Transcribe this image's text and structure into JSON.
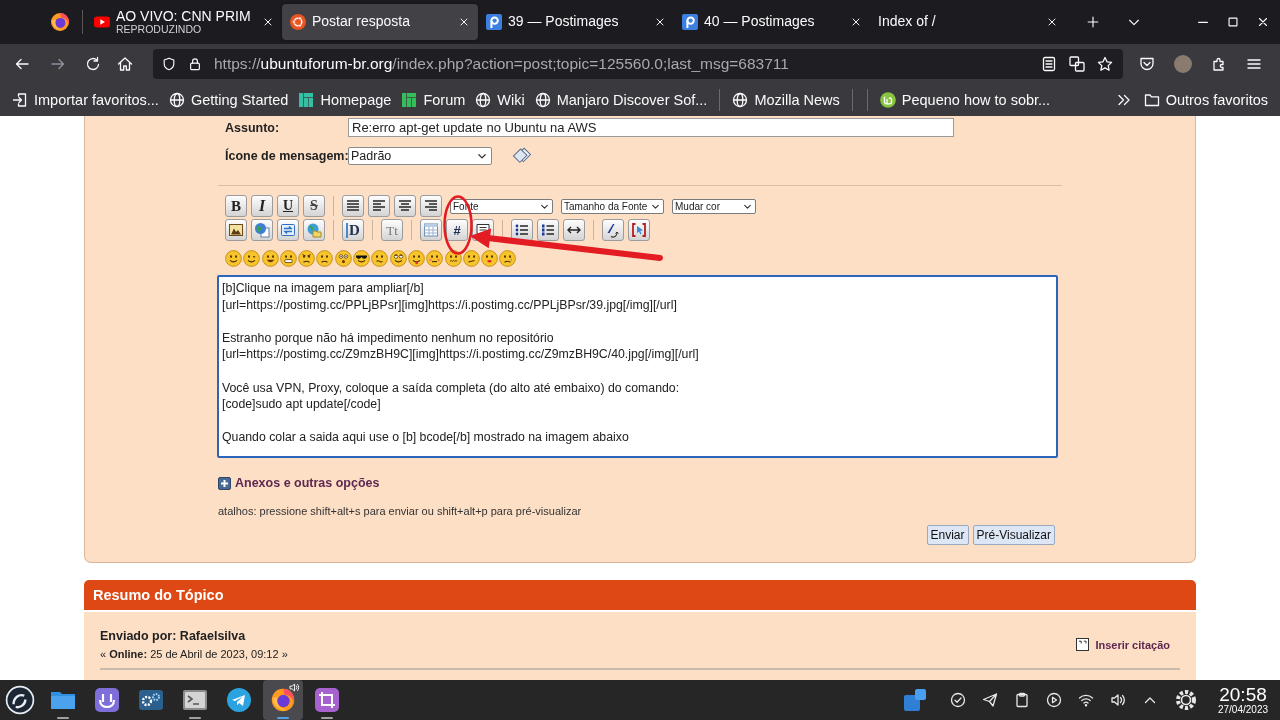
{
  "browser": {
    "tabs": [
      {
        "kind": "youtube",
        "title": "AO VIVO: CNN PRIM",
        "subtitle": "REPRODUZINDO",
        "selected": false
      },
      {
        "kind": "ubuntu",
        "title": "Postar resposta",
        "selected": true
      },
      {
        "kind": "postimages",
        "title": "39 — Postimages",
        "selected": false
      },
      {
        "kind": "postimages",
        "title": "40 — Postimages",
        "selected": false
      },
      {
        "kind": "none",
        "title": "Index of /",
        "selected": false
      }
    ],
    "address": {
      "scheme": "https://",
      "host": "ubuntuforum-br.org",
      "path": "/index.php?action=post;topic=125560.0;last_msg=683711"
    },
    "bookmarks": [
      {
        "kind": "import",
        "label": "Importar favoritos..."
      },
      {
        "kind": "globe",
        "label": "Getting Started"
      },
      {
        "kind": "manjaro",
        "label": "Homepage",
        "color": "#35bfa4"
      },
      {
        "kind": "manjaro",
        "label": "Forum",
        "color": "#34be5b"
      },
      {
        "kind": "globe",
        "label": "Wiki"
      },
      {
        "kind": "globe",
        "label": "Manjaro Discover Sof..."
      },
      {
        "kind": "separator"
      },
      {
        "kind": "globe",
        "label": "Mozilla News"
      },
      {
        "kind": "separator"
      },
      {
        "kind": "separator"
      },
      {
        "kind": "mint",
        "label": "Pequeno how to sobr..."
      }
    ],
    "other_bookmarks": "Outros favoritos"
  },
  "post_form": {
    "subject": {
      "label": "Assunto:",
      "value": "Re:erro apt-get update no Ubuntu na AWS"
    },
    "message_icon": {
      "label": "Ícone de mensagem:",
      "value": "Padrão"
    },
    "toolbar": [
      [
        {
          "kind": "bold",
          "label": "B"
        },
        {
          "kind": "italic",
          "label": "I"
        },
        {
          "kind": "underline",
          "label": "U"
        },
        {
          "kind": "strike",
          "label": "S"
        },
        {
          "kind": "separator"
        },
        {
          "kind": "pre"
        },
        {
          "kind": "left"
        },
        {
          "kind": "center"
        },
        {
          "kind": "right"
        },
        {
          "kind": "font",
          "value": "Fonte"
        },
        {
          "kind": "size",
          "value": "Tamanho da Fonte"
        },
        {
          "kind": "color",
          "value": "Mudar cor"
        }
      ],
      [
        {
          "kind": "image"
        },
        {
          "kind": "link"
        },
        {
          "kind": "email"
        },
        {
          "kind": "ftp"
        },
        {
          "kind": "separator"
        },
        {
          "kind": "flash",
          "label": "D"
        },
        {
          "kind": "separator"
        },
        {
          "kind": "teletype",
          "label": "Tt"
        },
        {
          "kind": "separator"
        },
        {
          "kind": "table"
        },
        {
          "kind": "code",
          "label": "#"
        },
        {
          "kind": "quote"
        },
        {
          "kind": "separator"
        },
        {
          "kind": "list"
        },
        {
          "kind": "orderedlist"
        },
        {
          "kind": "hr"
        },
        {
          "kind": "separator"
        },
        {
          "kind": "removeformat"
        },
        {
          "kind": "source"
        }
      ]
    ],
    "smileys": [
      {
        "kind": "smiley"
      },
      {
        "kind": "wink"
      },
      {
        "kind": "cheesy"
      },
      {
        "kind": "grin"
      },
      {
        "kind": "angry"
      },
      {
        "kind": "sad"
      },
      {
        "kind": "shocked"
      },
      {
        "kind": "cool"
      },
      {
        "kind": "huh"
      },
      {
        "kind": "rolleyes"
      },
      {
        "kind": "tongue"
      },
      {
        "kind": "embarrassed"
      },
      {
        "kind": "lipsrsealed"
      },
      {
        "kind": "undecided"
      },
      {
        "kind": "kiss"
      },
      {
        "kind": "cry"
      }
    ],
    "annotation": {
      "kind": "circle_arrow"
    },
    "message": {
      "value": "[b]Clique na imagem para ampliar[/b]\n[url=https://postimg.cc/PPLjBPsr][img]https://i.postimg.cc/PPLjBPsr/39.jpg[/img][/url]\n\nEstranho porque não há impedimento nenhum no repositório\n[url=https://postimg.cc/Z9mzBH9C][img]https://i.postimg.cc/Z9mzBH9C/40.jpg[/img][/url]\n\nVocê usa VPN, Proxy, coloque a saída completa (do alto até embaixo) do comando:\n[code]sudo apt update[/code]\n\nQuando colar a saida aqui use o [b] bcode[/b] mostrado na imagem abaixo"
    },
    "attachments_toggle": "Anexos e outras opções",
    "shortcuts_hint": "atalhos: pressione shift+alt+s para enviar ou shift+alt+p para pré-visualizar",
    "buttons": [
      "Enviar",
      "Pré-Visualizar"
    ]
  },
  "topic_summary": {
    "title": "Resumo do Tópico",
    "posts": [
      {
        "author": "Enviado por: Rafaelsilva",
        "date": "« **Online:** 25 de Abril de 2023, 09:12 »",
        "quote_link": "Inserir citação"
      }
    ]
  },
  "taskbar": {
    "apps": [
      {
        "kind": "files",
        "running": true,
        "selected": false,
        "playing_audio": false
      },
      {
        "kind": "store",
        "running": false,
        "selected": false,
        "playing_audio": false
      },
      {
        "kind": "settings",
        "running": false,
        "selected": false,
        "playing_audio": false
      },
      {
        "kind": "terminal",
        "running": true,
        "selected": false,
        "playing_audio": false
      },
      {
        "kind": "telegram",
        "running": false,
        "selected": false,
        "playing_audio": false
      },
      {
        "kind": "firefox",
        "running": true,
        "selected": true,
        "playing_audio": true
      },
      {
        "kind": "crop",
        "running": true,
        "selected": false,
        "playing_audio": false
      }
    ],
    "clock": {
      "time": "20:58",
      "date": "27/04/2023"
    }
  }
}
